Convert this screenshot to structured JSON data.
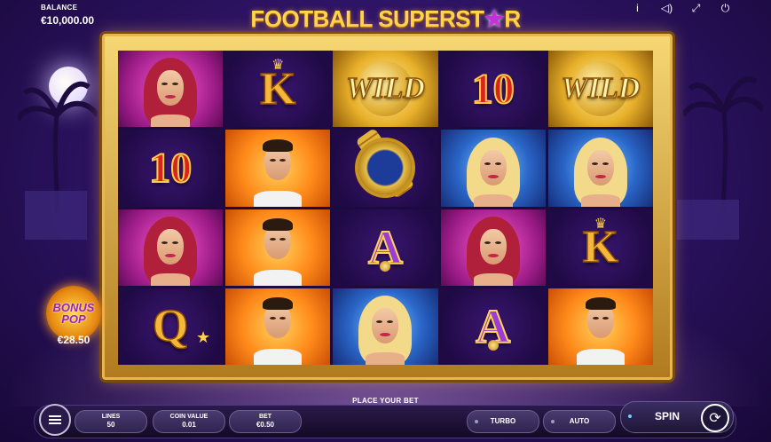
{
  "header": {
    "balance_label": "BALANCE",
    "balance_value": "€10,000.00",
    "title_part1": "FOOTBALL SUPERST",
    "title_star": "★",
    "title_part2": "R"
  },
  "top_icons": [
    {
      "name": "info-icon",
      "glyph": "i"
    },
    {
      "name": "sound-icon",
      "glyph": "◁)"
    },
    {
      "name": "fullscreen-icon",
      "glyph": "⤢"
    },
    {
      "name": "power-icon",
      "glyph": "⏻"
    }
  ],
  "reels": [
    [
      {
        "symbol": "woman-red-hair",
        "label": ""
      },
      {
        "symbol": "10",
        "label": "10"
      },
      {
        "symbol": "woman-red-hair",
        "label": ""
      },
      {
        "symbol": "Q",
        "label": "Q"
      }
    ],
    [
      {
        "symbol": "K",
        "label": "K"
      },
      {
        "symbol": "footballer",
        "label": ""
      },
      {
        "symbol": "footballer",
        "label": ""
      },
      {
        "symbol": "footballer",
        "label": ""
      }
    ],
    [
      {
        "symbol": "wild",
        "label": "WILD"
      },
      {
        "symbol": "watch",
        "label": ""
      },
      {
        "symbol": "A",
        "label": "A"
      },
      {
        "symbol": "woman-blonde",
        "label": ""
      }
    ],
    [
      {
        "symbol": "10",
        "label": "10"
      },
      {
        "symbol": "woman-blonde",
        "label": ""
      },
      {
        "symbol": "woman-red-hair",
        "label": ""
      },
      {
        "symbol": "A",
        "label": "A"
      }
    ],
    [
      {
        "symbol": "wild",
        "label": "WILD"
      },
      {
        "symbol": "woman-blonde",
        "label": ""
      },
      {
        "symbol": "K",
        "label": "K"
      },
      {
        "symbol": "footballer",
        "label": ""
      }
    ]
  ],
  "bonus": {
    "line1": "BONUS",
    "line2": "POP",
    "amount": "€28.50"
  },
  "controls": {
    "place_bet": "PLACE YOUR BET",
    "lines_label": "LINES",
    "lines_value": "50",
    "coin_label": "COIN VALUE",
    "coin_value": "0.01",
    "bet_label": "BET",
    "bet_value": "€0.50",
    "turbo_label": "TURBO",
    "auto_label": "AUTO",
    "spin_label": "SPIN"
  }
}
